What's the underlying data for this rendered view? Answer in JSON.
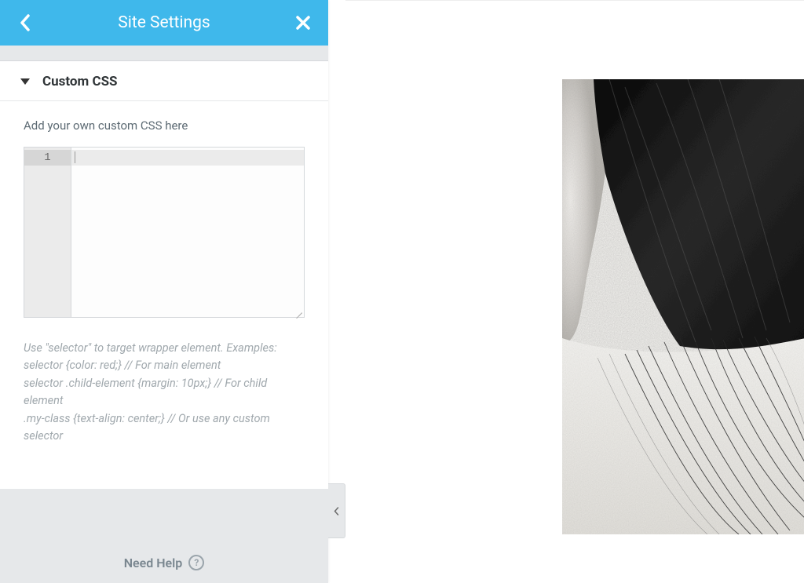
{
  "header": {
    "title": "Site Settings"
  },
  "section": {
    "title": "Custom CSS",
    "label": "Add your own custom CSS here",
    "line_number": "1",
    "hint": "Use \"selector\" to target wrapper element. Examples:\nselector {color: red;} // For main element\nselector .child-element {margin: 10px;} // For child element\n.my-class {text-align: center;} // Or use any custom selector"
  },
  "footer": {
    "help_label": "Need Help"
  }
}
